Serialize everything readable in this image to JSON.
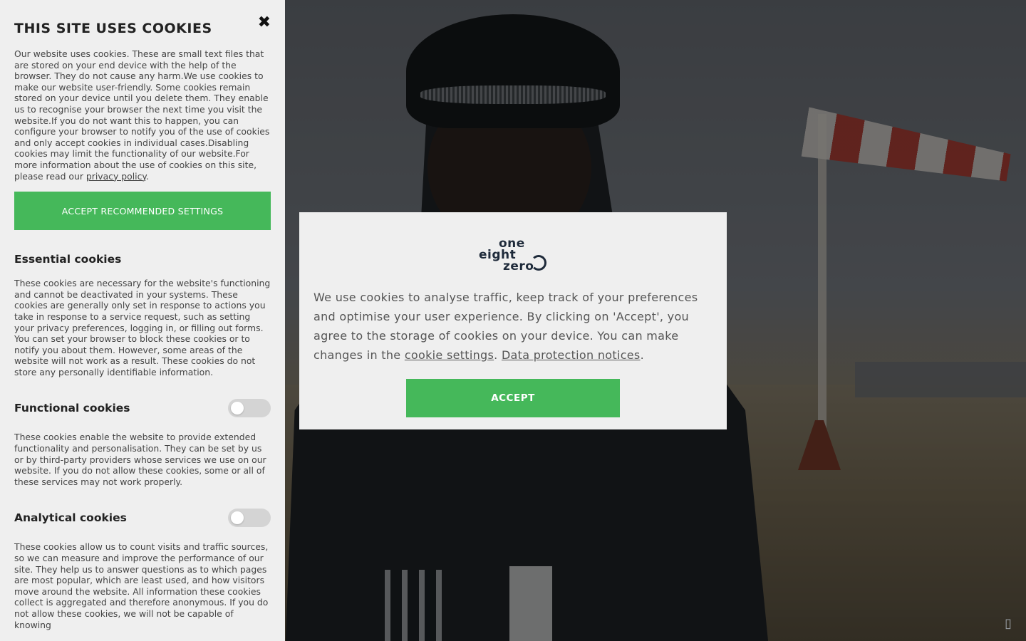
{
  "panel": {
    "title": "THIS SITE USES COOKIES",
    "close_icon": "close-icon",
    "intro_text": "Our website uses cookies. These are small text files that are stored on your end device with the help of the browser. They do not cause any harm.We use cookies to make our website user-friendly. Some cookies remain stored on your device until you delete them. They enable us to recognise your browser the next time you visit the website.If you do not want this to happen, you can configure your browser to notify you of the use of cookies and only accept cookies in individual cases.Disabling cookies may limit the functionality of our website.For more information about the use of cookies on this site, please read our ",
    "privacy_link": "privacy policy",
    "intro_end": ".",
    "accept_recommended": "ACCEPT RECOMMENDED SETTINGS",
    "sections": {
      "essential": {
        "title": "Essential cookies",
        "text": "These cookies are necessary for the website's functioning and cannot be deactivated in your systems. These cookies are generally only set in response to actions you take in response to a service request, such as setting your privacy preferences, logging in, or filling out forms. You can set your browser to block these cookies or to notify you about them. However, some areas of the website will not work as a result. These cookies do not store any personally identifiable information."
      },
      "functional": {
        "title": "Functional cookies",
        "enabled": false,
        "text": "These cookies enable the website to provide extended functionality and personalisation. They can be set by us or by third-party providers whose services we use on our website. If you do not allow these cookies, some or all of these services may not work properly."
      },
      "analytical": {
        "title": "Analytical cookies",
        "enabled": false,
        "text": "These cookies allow us to count visits and traffic sources, so we can measure and improve the performance of our site. They help us to answer questions as to which pages are most popular, which are least used, and how visitors move around the website. All information these cookies collect is aggregated and therefore anonymous. If you do not allow these cookies, we will not be capable of knowing"
      }
    }
  },
  "modal": {
    "logo": {
      "line1": "one",
      "line2": "eight",
      "line3": "zero"
    },
    "text_before": "We use cookies to analyse traffic, keep track of your preferences and optimise your user experience. By clicking on 'Accept', you agree to the storage of cookies on your device. You can make changes in the ",
    "cookie_settings_link": "cookie settings",
    "separator": ". ",
    "data_protection_link": "Data protection notices",
    "text_end": ".",
    "accept_label": "ACCEPT"
  },
  "colors": {
    "accent": "#45b85a",
    "panel_bg": "#efefef",
    "logo": "#1e2a3a"
  },
  "icons": {
    "corner": "box-glyph-icon"
  }
}
